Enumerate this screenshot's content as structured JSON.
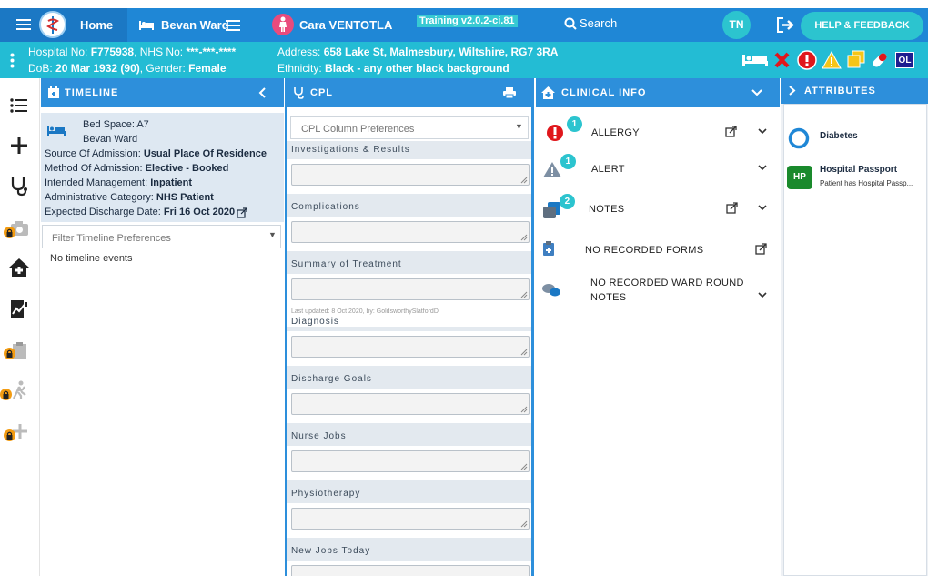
{
  "nav": {
    "home": "Home",
    "ward": "Bevan Ward",
    "patient": "Cara VENTOTLA",
    "build": "Training v2.0.2-ci.81",
    "search_placeholder": "Search",
    "user_initials": "TN",
    "help": "HELP & FEEDBACK"
  },
  "banner": {
    "hospital_label": "Hospital No:",
    "hospital_no": "F775938",
    "nhs_label": ", NHS No:",
    "nhs_no": "***-***-****",
    "dob_label": "DoB:",
    "dob": "20 Mar 1932 (90)",
    "gender_label": ", Gender:",
    "gender": "Female",
    "address_label": "Address:",
    "address": "658 Lake St, Malmesbury, Wiltshire, RG7 3RA",
    "ethnicity_label": "Ethnicity:",
    "ethnicity": "Black - any other black background",
    "ol": "OL"
  },
  "timeline": {
    "title": "TIMELINE",
    "bed_space": "Bed Space: A7",
    "ward": "Bevan Ward",
    "source_label": "Source Of Admission:",
    "source": "Usual Place Of Residence",
    "method_label": "Method Of Admission:",
    "method": "Elective - Booked",
    "intended_label": "Intended Management:",
    "intended": "Inpatient",
    "admin_label": "Administrative Category:",
    "admin": "NHS Patient",
    "discharge_label": "Expected Discharge Date:",
    "discharge": "Fri 16 Oct 2020",
    "filter_placeholder": "Filter Timeline Preferences",
    "empty": "No timeline events"
  },
  "cpl": {
    "title": "CPL",
    "column_prefs": "CPL Column Preferences",
    "sections": [
      "Investigations & Results",
      "Complications",
      "Summary of Treatment",
      "Diagnosis",
      "Discharge Goals",
      "Nurse Jobs",
      "Physiotherapy",
      "New Jobs Today"
    ],
    "last_updated": "Last updated: 8 Oct 2020, by: GoldsworthySlatfordD"
  },
  "clinical": {
    "title": "CLINICAL INFO",
    "allergy": "ALLERGY",
    "allergy_count": "1",
    "alert": "ALERT",
    "alert_count": "1",
    "notes": "NOTES",
    "notes_count": "2",
    "forms": "NO RECORDED FORMS",
    "ward_round_1": "NO RECORDED WARD ROUND",
    "ward_round_2": "NOTES"
  },
  "attributes": {
    "title": "ATTRIBUTES",
    "diabetes": "Diabetes",
    "hp_badge": "HP",
    "hp_title": "Hospital Passport",
    "hp_desc": "Patient has Hospital Passp..."
  },
  "colors": {
    "nav_blue": "#1f87d6",
    "banner_teal": "#23bcd4",
    "accent_teal": "#2cc4cf",
    "lock_orange": "#f39c12",
    "alert_red": "#e0161b"
  }
}
